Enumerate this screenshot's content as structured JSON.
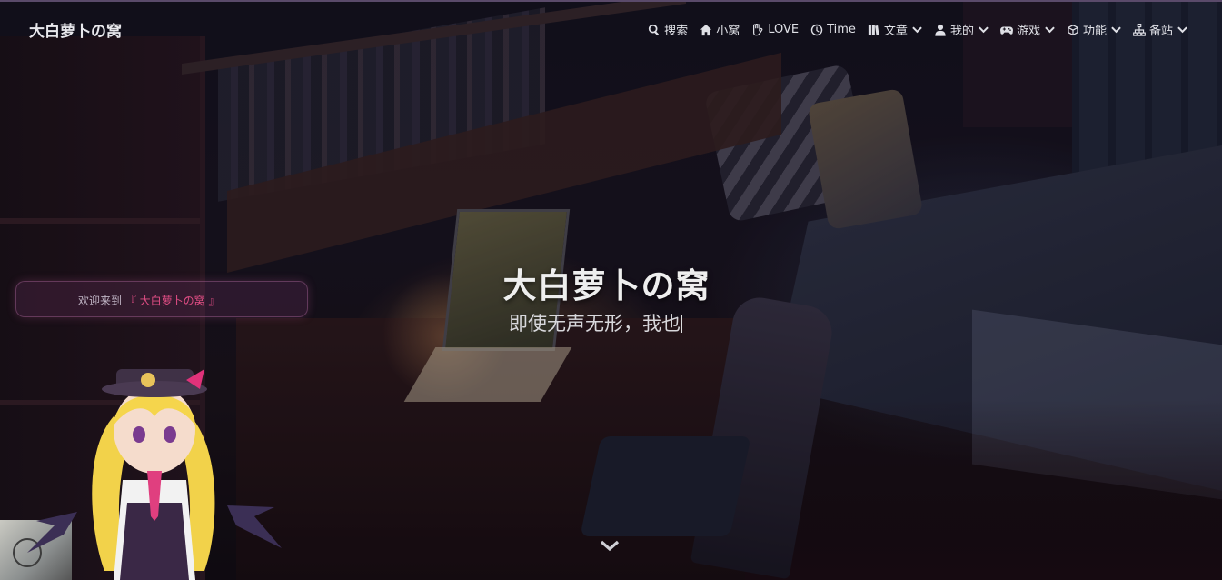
{
  "brand": {
    "name": "大白萝卜の窝"
  },
  "nav": {
    "items": [
      {
        "label": "搜索",
        "icon": "search-icon",
        "dropdown": false
      },
      {
        "label": "小窝",
        "icon": "home-icon",
        "dropdown": false
      },
      {
        "label": "LOVE",
        "icon": "hand-icon",
        "dropdown": false
      },
      {
        "label": "Time",
        "icon": "clock-icon",
        "dropdown": false
      },
      {
        "label": "文章",
        "icon": "books-icon",
        "dropdown": true
      },
      {
        "label": "我的",
        "icon": "user-icon",
        "dropdown": true
      },
      {
        "label": "游戏",
        "icon": "gamepad-icon",
        "dropdown": true
      },
      {
        "label": "功能",
        "icon": "cube-icon",
        "dropdown": true
      },
      {
        "label": "备站",
        "icon": "sitemap-icon",
        "dropdown": true
      }
    ]
  },
  "hero": {
    "title": "大白萝卜の窝",
    "subtitle": "即使无声无形，我也"
  },
  "welcome": {
    "prefix": "欢迎来到",
    "site": "『 大白萝卜の窝 』"
  },
  "colors": {
    "accent": "#e04d84",
    "nav_text": "#dfe0e6",
    "title_text": "#eeeeee"
  }
}
